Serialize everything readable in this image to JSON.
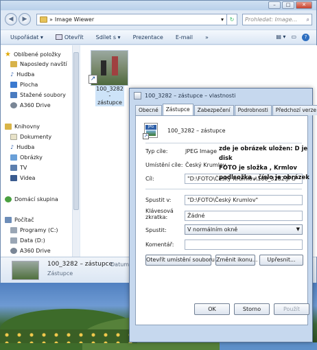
{
  "window": {
    "controls": [
      "–",
      "□",
      "✕"
    ]
  },
  "address": {
    "path_chevron": "»",
    "folder": "Image Wiewer",
    "search_placeholder": "Prohledat: Image..."
  },
  "toolbar": {
    "organize": "Uspořádat ▾",
    "open": "Otevřít",
    "share": "Sdílet s ▾",
    "presentation": "Prezentace",
    "email": "E-mail",
    "more": "»"
  },
  "nav": {
    "favorites_title": "Oblíbené položky",
    "favorites": [
      "Naposledy navští",
      "Hudba",
      "Plocha",
      "Stažené soubory",
      "A360 Drive"
    ],
    "libraries_title": "Knihovny",
    "libraries": [
      "Dokumenty",
      "Hudba",
      "Obrázky",
      "TV",
      "Videa"
    ],
    "homegroup": "Domácí skupina",
    "computer_title": "Počítač",
    "computer": [
      "Programy (C:)",
      "Data (D:)",
      "A360 Drive"
    ]
  },
  "file": {
    "name_line1": "100_3282 -",
    "name_line2": "zástupce"
  },
  "details": {
    "name": "100_3282 – zástupce",
    "type": "Zástupce",
    "datum_label": "Datum"
  },
  "dialog": {
    "title": "100_3282 – zástupce – vlastnosti",
    "tabs": [
      "Obecné",
      "Zástupce",
      "Zabezpečení",
      "Podrobnosti",
      "Předchozí verze"
    ],
    "icon_text": "JPG",
    "name": "100_3282 – zástupce",
    "type_label": "Typ cíle:",
    "type_value": "JPEG Image",
    "location_label": "Umístění cíle:",
    "location_value": "Český Krumlov",
    "target_label": "Cíl:",
    "target_value": "\"D:\\FOTO\\Český Krumlov\\100_3282.JPG\"",
    "start_label": "Spustit v:",
    "start_value": "\"D:\\FOTO\\Český Krumlov\"",
    "hotkey_label": "Klávesová\nzkratka:",
    "hotkey_value": "Žádné",
    "run_label": "Spustit:",
    "run_value": "V normálním okně",
    "comment_label": "Komentář:",
    "comment_value": "",
    "open_location_btn": "Otevřít umístění souboru",
    "change_icon_btn": "Změnit ikonu...",
    "advanced_btn": "Upřesnit...",
    "ok": "OK",
    "cancel": "Storno",
    "apply": "Použít",
    "annotation": "zde je obrázek uložen: D je disk\nFOTO je složka , Krmlov\npodlsožka , číslo je obrázek"
  }
}
